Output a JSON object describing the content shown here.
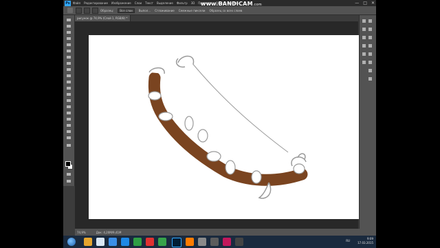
{
  "app": {
    "logo": "Ps",
    "menu": [
      "Файл",
      "Редактирование",
      "Изображение",
      "Слои",
      "Текст",
      "Выделение",
      "Фильтр",
      "3D",
      "Просмотр",
      "Окно",
      "Справка"
    ],
    "window_controls": [
      "—",
      "□",
      "✕"
    ]
  },
  "watermark": {
    "brand": "www.BANDICAM",
    "domain": ".com"
  },
  "options_bar": {
    "label1": "Образец:",
    "field1": "Все слои",
    "label2": "Выпол...",
    "label3": "Сглаживание",
    "label4": "Смежные пиксели",
    "label5": "Образец со всех слоев"
  },
  "document": {
    "tab_title": "рисунок @ 74,9% (Слой 1, RGB/8) *",
    "zoom": "74,9%",
    "doc_size": "Док: 4,20M/9,41M"
  },
  "colors": {
    "bow_fill": "#7a4420",
    "outline": "#9a9a9a",
    "canvas": "#ffffff",
    "workspace": "#282828",
    "panel": "#535353"
  },
  "taskbar": {
    "tray_lang": "RU",
    "time": "9:09",
    "date": "17.03.2015"
  }
}
